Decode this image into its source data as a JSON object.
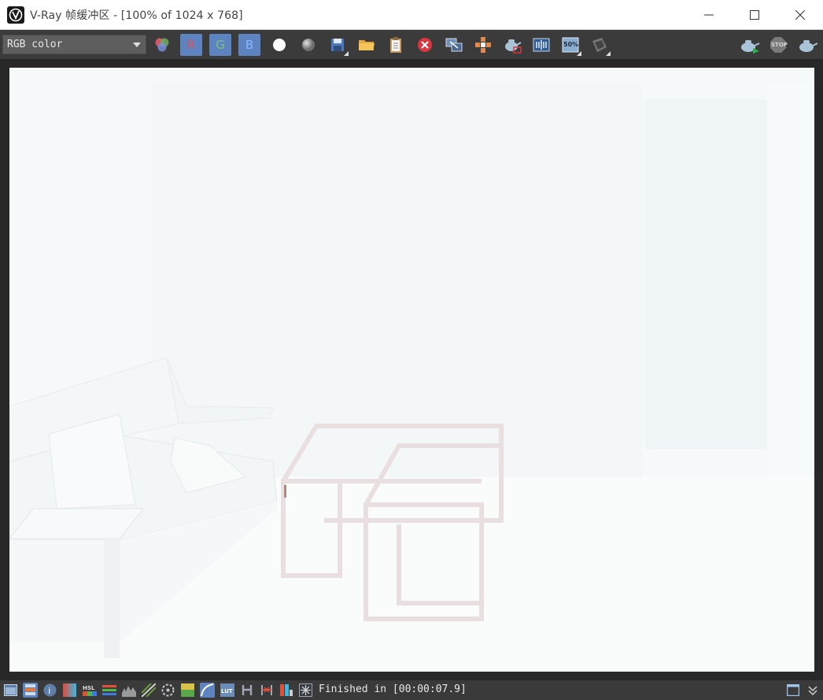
{
  "window": {
    "title": "V-Ray 帧缓冲区 - [100% of 1024 x 768]",
    "logo_icon": "vray-logo-icon",
    "controls": [
      "minimize-icon",
      "maximize-icon",
      "close-icon"
    ]
  },
  "toolbar": {
    "channel_select": {
      "value": "RGB color"
    },
    "channel_buttons": {
      "r": "R",
      "g": "G",
      "b": "B"
    },
    "zoom_label": "50%",
    "stop_label": "STOP",
    "icons": [
      "color-channels-icon",
      "red-channel-button",
      "green-channel-button",
      "blue-channel-button",
      "view-white-icon",
      "view-mono-icon",
      "save-image-icon",
      "load-image-icon",
      "copy-clipboard-icon",
      "clear-image-icon",
      "link-vfb-icon",
      "track-mouse-icon",
      "render-region-icon",
      "compare-ab-icon",
      "zoom-50-icon",
      "render-history-icon",
      "interactive-render-icon",
      "stop-render-icon",
      "render-icon"
    ],
    "colors": {
      "r": "#e0505a",
      "g": "#7fbf7f",
      "b": "#8fb2ff",
      "selected_bg": "#5d84c0"
    }
  },
  "status": {
    "text": "Finished in [00:00:07.9]",
    "icons": [
      "history-icon",
      "layers-icon",
      "info-icon",
      "color-correction-icon",
      "hsl-icon",
      "levels-icon",
      "curves-icon",
      "exposure-icon",
      "lens-effects-icon",
      "background-icon",
      "curve-icon",
      "lut-icon",
      "h-icon",
      "stereo-icon",
      "bars-icon",
      "ocio-icon",
      "panel-toggle-icon",
      "expand-icon"
    ]
  }
}
